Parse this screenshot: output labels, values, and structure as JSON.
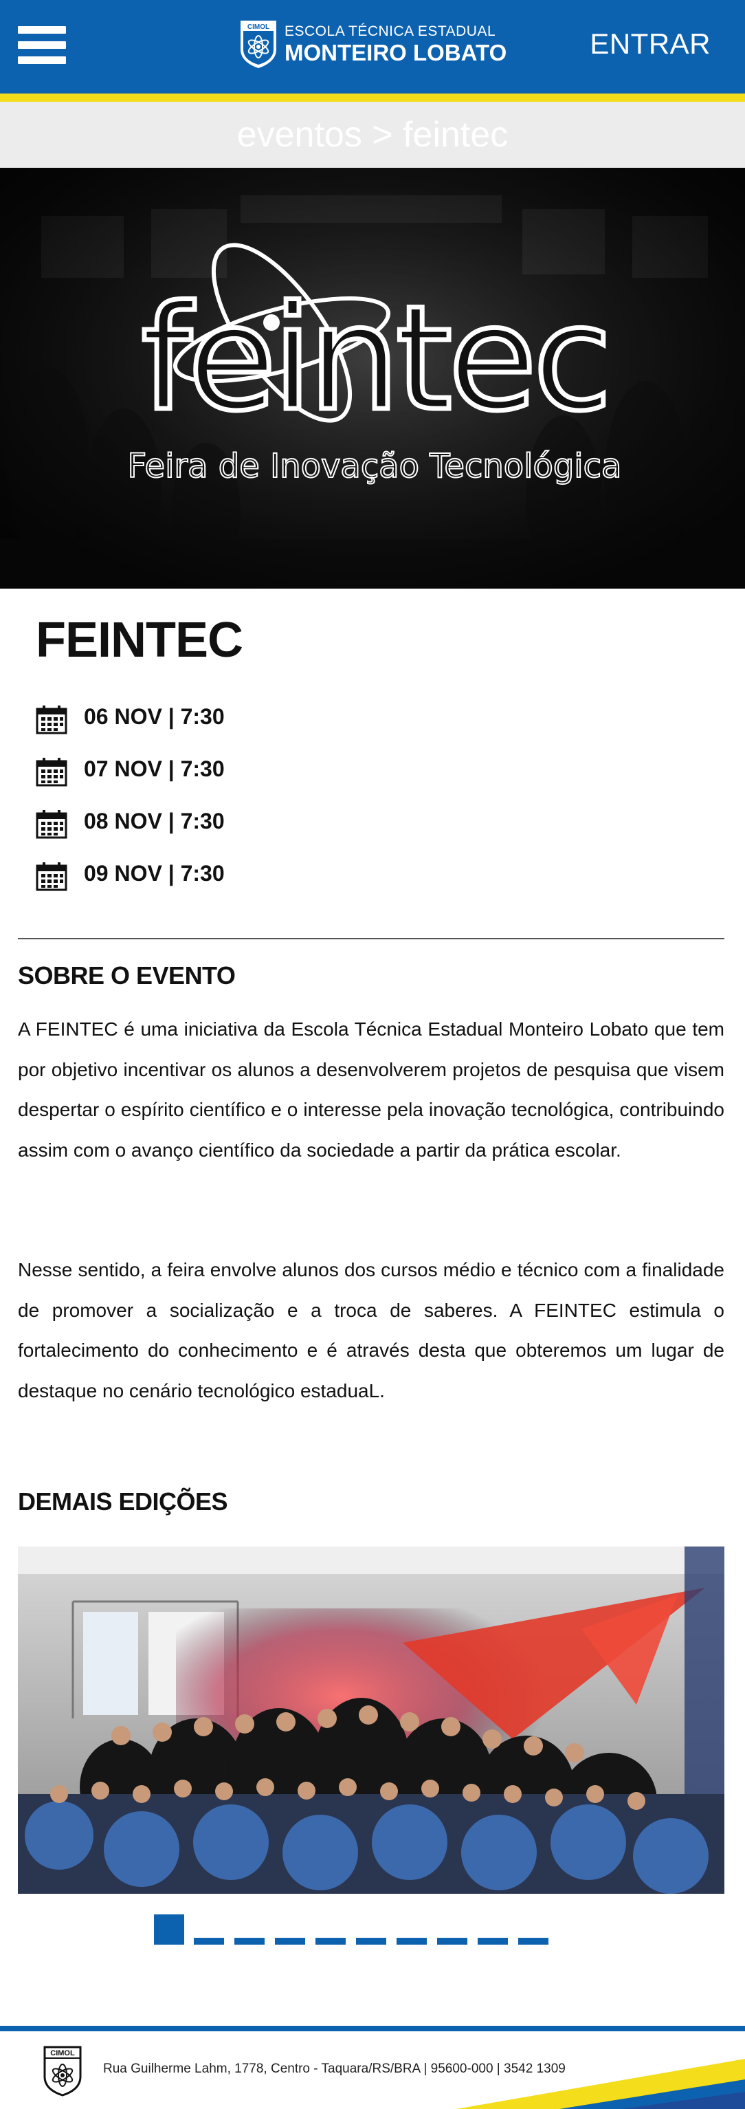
{
  "header": {
    "menu_icon": "hamburger-menu-icon",
    "logo": {
      "badge_text": "CIMOL",
      "line1": "ESCOLA TÉCNICA ESTADUAL",
      "line2": "MONTEIRO LOBATO"
    },
    "login_label": "ENTRAR",
    "colors": {
      "primary": "#0d62b0",
      "accent": "#f4dd1b"
    }
  },
  "breadcrumb": {
    "text": "eventos > feintec"
  },
  "banner": {
    "logo_text": "feintec",
    "subtitle": "Feira de Inovação Tecnológica"
  },
  "event": {
    "title": "FEINTEC",
    "date_icon": "calendar-icon",
    "dates": [
      {
        "label": "06 NOV | 7:30"
      },
      {
        "label": "07 NOV | 7:30"
      },
      {
        "label": "08 NOV | 7:30"
      },
      {
        "label": "09 NOV | 7:30"
      }
    ]
  },
  "about": {
    "title": "SOBRE O EVENTO",
    "paragraphs": [
      "A FEINTEC é uma iniciativa da Escola Técnica Estadual Monteiro Lobato que tem por objetivo incentivar os alunos a desenvolverem projetos de pesquisa que visem despertar o espírito científico e o interesse pela inovação tecnológica, contribuindo assim com o avanço científico da sociedade a partir da prática escolar.",
      "Nesse sentido, a feira envolve alunos dos cursos médio e técnico com a finalidade de promover a socialização e a troca de saberes. A FEINTEC estimula o fortalecimento do conhecimento e é através desta que obteremos um lugar de destaque no cenário tecnológico estaduaL."
    ]
  },
  "editions": {
    "title": "DEMAIS EDIÇÕES",
    "slide_count": 10,
    "active_slide": 1
  },
  "footer": {
    "badge_text": "CIMOL",
    "address": "Rua Guilherme Lahm, 1778, Centro - Taquara/RS/BRA | 95600-000 | 3542 1309"
  }
}
